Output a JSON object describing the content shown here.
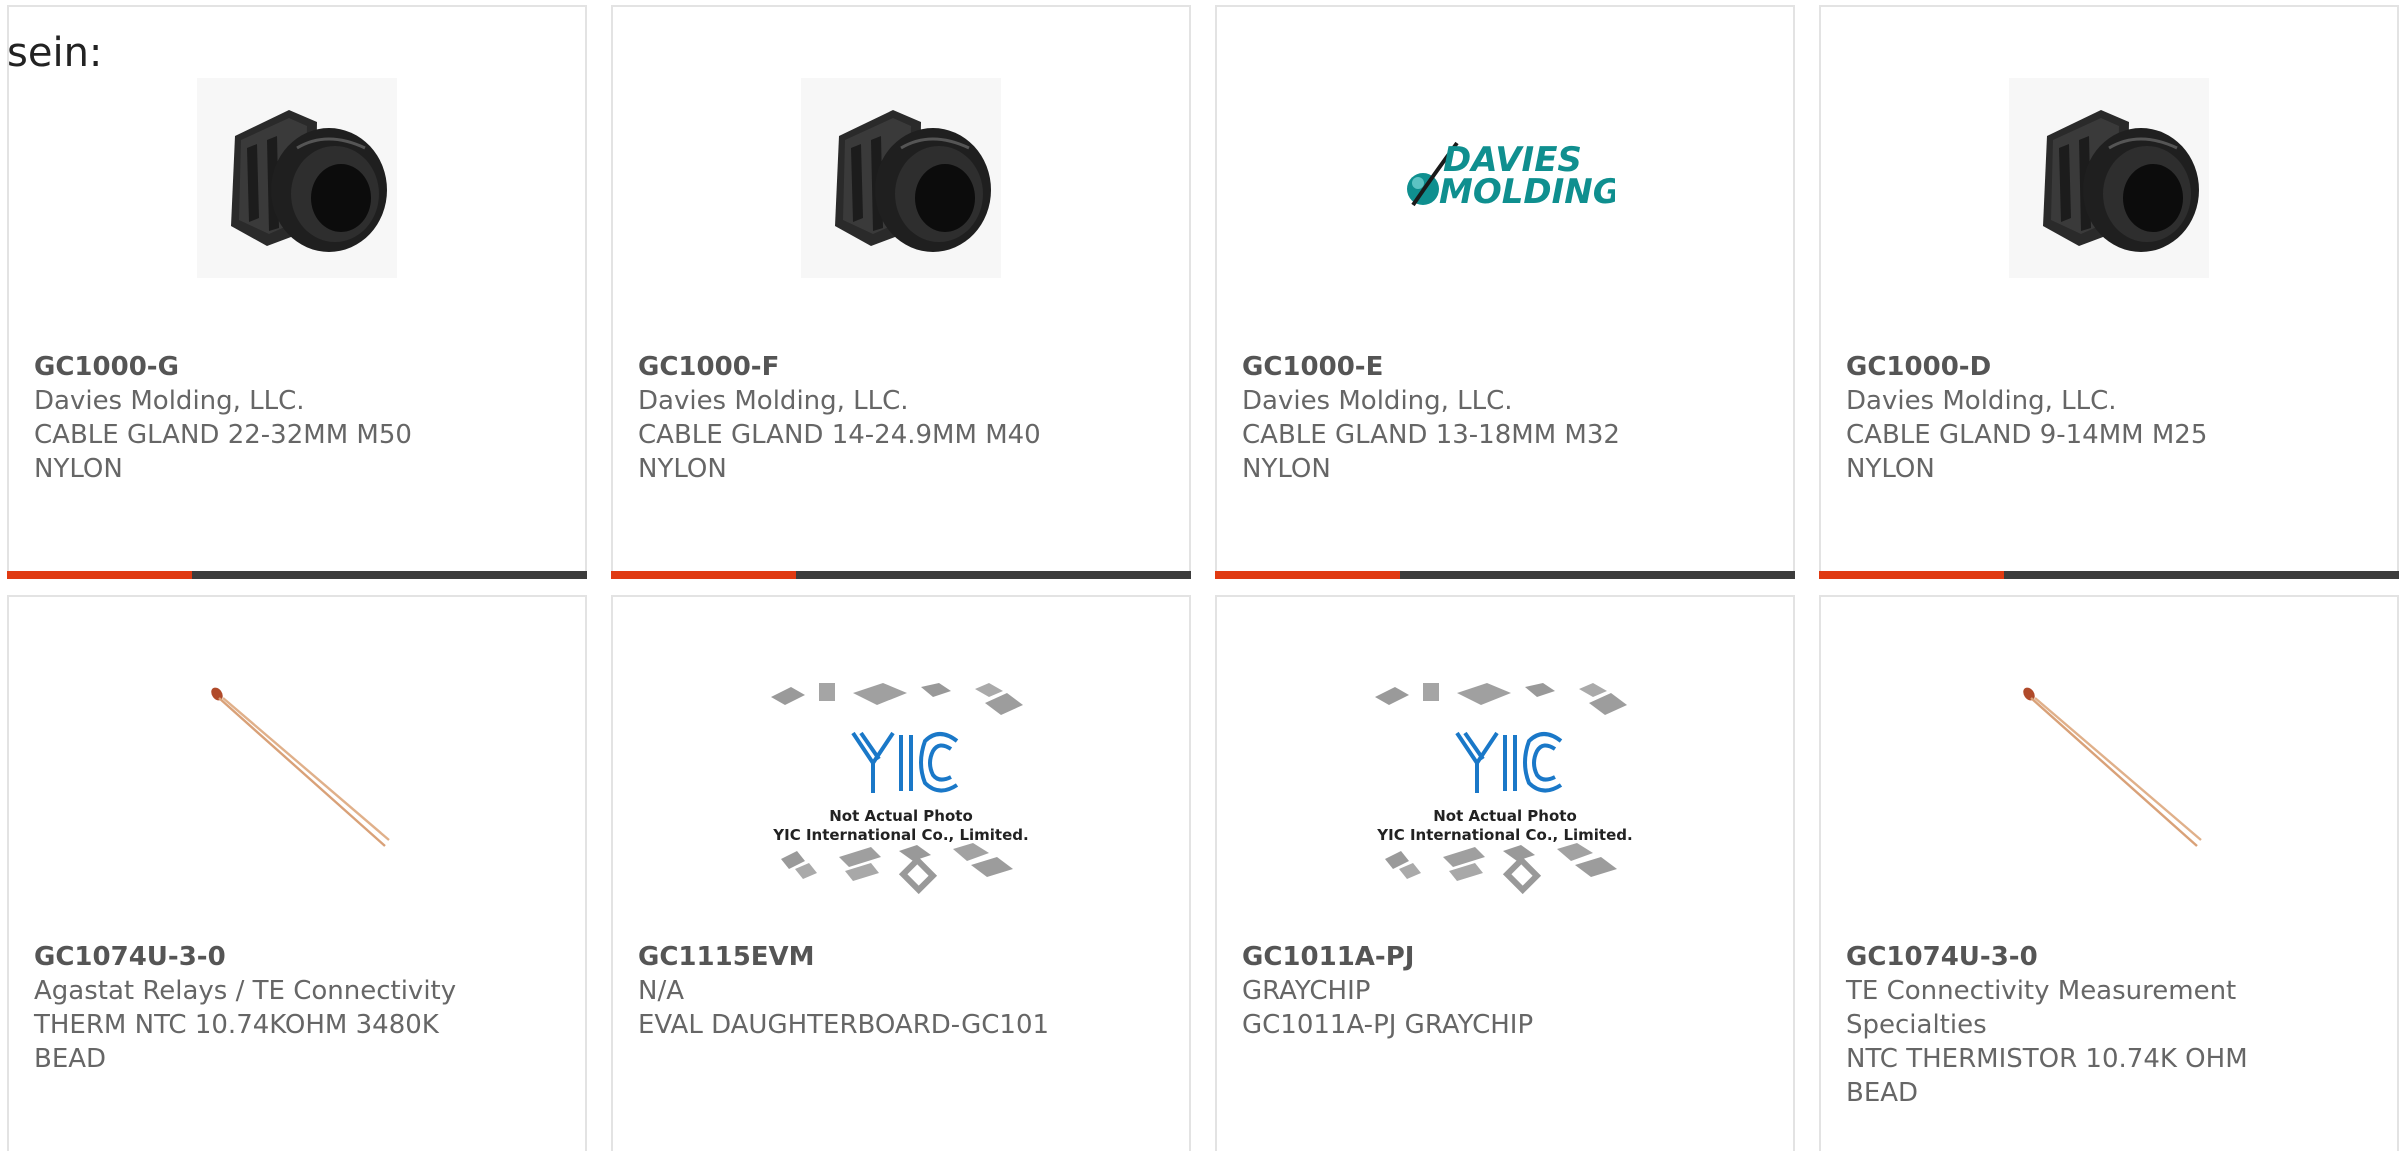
{
  "intro_text": "sein:",
  "colors": {
    "accent": "#e03a12",
    "bar_dark": "#3c3c3c",
    "text": "#666666",
    "card_border": "#e3e3e3",
    "davies_teal": "#0f8f8f",
    "yic_blue": "#1a78c8"
  },
  "products": [
    {
      "part": "GC1000-G",
      "manufacturer": "Davies Molding, LLC.",
      "desc1": "CABLE GLAND 22-32MM M50",
      "desc2": "NYLON",
      "image": "cable-gland-photo"
    },
    {
      "part": "GC1000-F",
      "manufacturer": "Davies Molding, LLC.",
      "desc1": "CABLE GLAND 14-24.9MM M40",
      "desc2": "NYLON",
      "image": "cable-gland-photo"
    },
    {
      "part": "GC1000-E",
      "manufacturer": "Davies Molding, LLC.",
      "desc1": "CABLE GLAND 13-18MM M32",
      "desc2": "NYLON",
      "image": "davies-molding-logo",
      "logo_line1": "DAVIES",
      "logo_line2": "MOLDING"
    },
    {
      "part": "GC1000-D",
      "manufacturer": "Davies Molding, LLC.",
      "desc1": "CABLE GLAND 9-14MM M25",
      "desc2": "NYLON",
      "image": "cable-gland-photo"
    },
    {
      "part": "GC1074U-3-0",
      "manufacturer": "Agastat Relays / TE Connectivity",
      "desc1": "THERM NTC 10.74KOHM 3480K",
      "desc2": "BEAD",
      "image": "thermistor-photo"
    },
    {
      "part": "GC1115EVM",
      "manufacturer": "N/A",
      "desc1": "EVAL DAUGHTERBOARD-GC101",
      "desc2": "",
      "image": "yic-placeholder",
      "placeholder_line1": "Not Actual Photo",
      "placeholder_line2": "YIC International Co., Limited."
    },
    {
      "part": "GC1011A-PJ",
      "manufacturer": "GRAYCHIP",
      "desc1": "GC1011A-PJ GRAYCHIP",
      "desc2": "",
      "image": "yic-placeholder",
      "placeholder_line1": "Not Actual Photo",
      "placeholder_line2": "YIC International Co., Limited."
    },
    {
      "part": "GC1074U-3-0",
      "manufacturer": "TE Connectivity Measurement Specialties",
      "desc1": "NTC THERMISTOR 10.74K OHM",
      "desc2": "BEAD",
      "image": "thermistor-photo"
    }
  ]
}
